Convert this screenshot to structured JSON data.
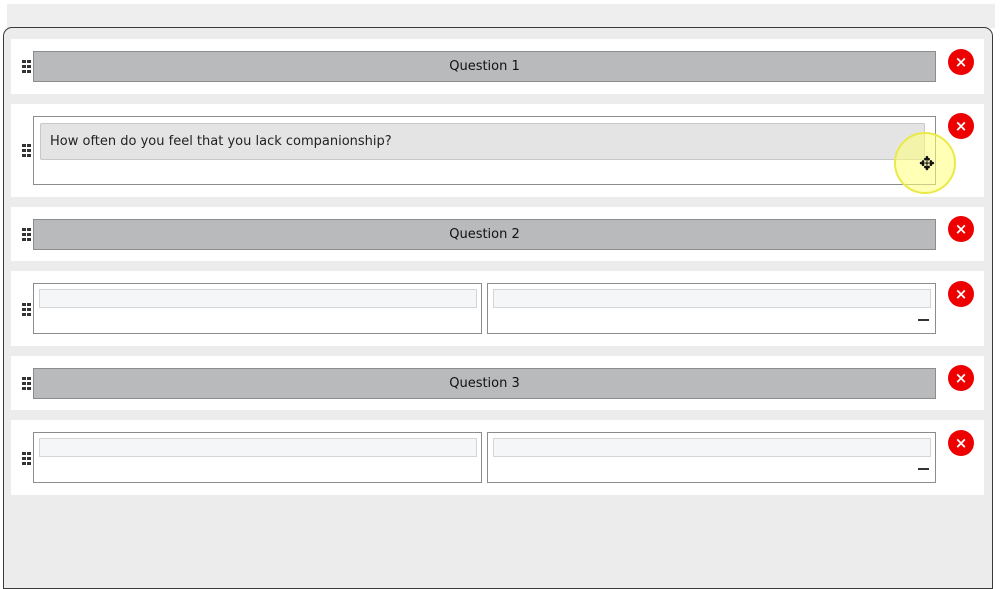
{
  "rows": [
    {
      "type": "header",
      "label": "Question 1"
    },
    {
      "type": "question",
      "text": "How often do you feel that you lack companionship?"
    },
    {
      "type": "header",
      "label": "Question 2"
    },
    {
      "type": "answer"
    },
    {
      "type": "header",
      "label": "Question 3"
    },
    {
      "type": "answer"
    }
  ],
  "icons": {
    "drag_handle": "drag-handle-icon",
    "delete": "close-icon",
    "delete_glyph": "×",
    "remove_option": "minus-icon",
    "cursor": "move-cursor-icon"
  },
  "colors": {
    "delete_button": "#ee0000",
    "header_bar": "#b9babc",
    "question_input": "#e4e4e4",
    "background": "#ececec"
  }
}
